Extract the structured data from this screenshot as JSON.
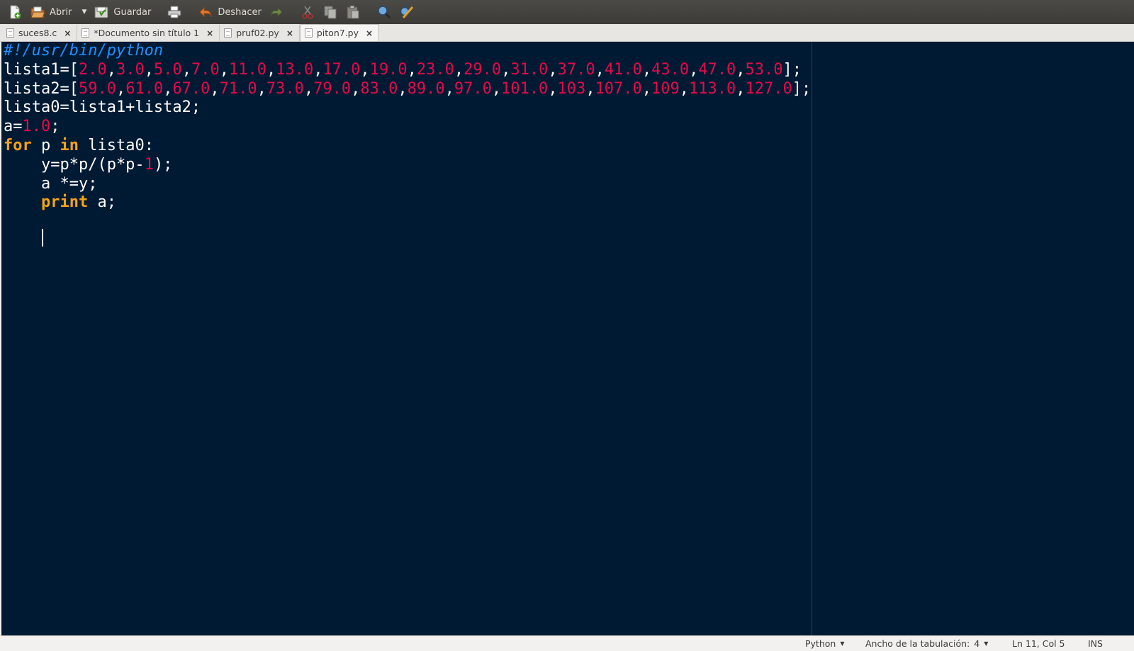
{
  "toolbar": {
    "new_icon": "new-document-icon",
    "open_label": "Abrir",
    "save_label": "Guardar",
    "undo_label": "Deshacer"
  },
  "tabs": [
    {
      "label": "suces8.c",
      "close": "×"
    },
    {
      "label": "*Documento sin título 1",
      "close": "×"
    },
    {
      "label": "pruf02.py",
      "close": "×"
    },
    {
      "label": "piton7.py",
      "close": "×",
      "active": true
    }
  ],
  "editor": {
    "lines": [
      [
        {
          "t": "#!/usr/bin/python",
          "c": "cm"
        }
      ],
      [
        {
          "t": "lista1=[",
          "c": ""
        },
        {
          "t": "2.0",
          "c": "num"
        },
        {
          "t": ",",
          "c": ""
        },
        {
          "t": "3.0",
          "c": "num"
        },
        {
          "t": ",",
          "c": ""
        },
        {
          "t": "5.0",
          "c": "num"
        },
        {
          "t": ",",
          "c": ""
        },
        {
          "t": "7.0",
          "c": "num"
        },
        {
          "t": ",",
          "c": ""
        },
        {
          "t": "11.0",
          "c": "num"
        },
        {
          "t": ",",
          "c": ""
        },
        {
          "t": "13.0",
          "c": "num"
        },
        {
          "t": ",",
          "c": ""
        },
        {
          "t": "17.0",
          "c": "num"
        },
        {
          "t": ",",
          "c": ""
        },
        {
          "t": "19.0",
          "c": "num"
        },
        {
          "t": ",",
          "c": ""
        },
        {
          "t": "23.0",
          "c": "num"
        },
        {
          "t": ",",
          "c": ""
        },
        {
          "t": "29.0",
          "c": "num"
        },
        {
          "t": ",",
          "c": ""
        },
        {
          "t": "31.0",
          "c": "num"
        },
        {
          "t": ",",
          "c": ""
        },
        {
          "t": "37.0",
          "c": "num"
        },
        {
          "t": ",",
          "c": ""
        },
        {
          "t": "41.0",
          "c": "num"
        },
        {
          "t": ",",
          "c": ""
        },
        {
          "t": "43.0",
          "c": "num"
        },
        {
          "t": ",",
          "c": ""
        },
        {
          "t": "47.0",
          "c": "num"
        },
        {
          "t": ",",
          "c": ""
        },
        {
          "t": "53.0",
          "c": "num"
        },
        {
          "t": "];",
          "c": ""
        }
      ],
      [
        {
          "t": "lista2=[",
          "c": ""
        },
        {
          "t": "59.0",
          "c": "num"
        },
        {
          "t": ",",
          "c": ""
        },
        {
          "t": "61.0",
          "c": "num"
        },
        {
          "t": ",",
          "c": ""
        },
        {
          "t": "67.0",
          "c": "num"
        },
        {
          "t": ",",
          "c": ""
        },
        {
          "t": "71.0",
          "c": "num"
        },
        {
          "t": ",",
          "c": ""
        },
        {
          "t": "73.0",
          "c": "num"
        },
        {
          "t": ",",
          "c": ""
        },
        {
          "t": "79.0",
          "c": "num"
        },
        {
          "t": ",",
          "c": ""
        },
        {
          "t": "83.0",
          "c": "num"
        },
        {
          "t": ",",
          "c": ""
        },
        {
          "t": "89.0",
          "c": "num"
        },
        {
          "t": ",",
          "c": ""
        },
        {
          "t": "97.0",
          "c": "num"
        },
        {
          "t": ",",
          "c": ""
        },
        {
          "t": "101.0",
          "c": "num"
        },
        {
          "t": ",",
          "c": ""
        },
        {
          "t": "103",
          "c": "num"
        },
        {
          "t": ",",
          "c": ""
        },
        {
          "t": "107.0",
          "c": "num"
        },
        {
          "t": ",",
          "c": ""
        },
        {
          "t": "109",
          "c": "num"
        },
        {
          "t": ",",
          "c": ""
        },
        {
          "t": "113.0",
          "c": "num"
        },
        {
          "t": ",",
          "c": ""
        },
        {
          "t": "127.0",
          "c": "num"
        },
        {
          "t": "];",
          "c": ""
        }
      ],
      [
        {
          "t": "lista0=lista1+lista2;",
          "c": ""
        }
      ],
      [
        {
          "t": "a=",
          "c": ""
        },
        {
          "t": "1.0",
          "c": "num"
        },
        {
          "t": ";",
          "c": ""
        }
      ],
      [
        {
          "t": "for",
          "c": "kw"
        },
        {
          "t": " p ",
          "c": ""
        },
        {
          "t": "in",
          "c": "kw"
        },
        {
          "t": " lista0:",
          "c": ""
        }
      ],
      [
        {
          "t": "    y=p*p/(p*p-",
          "c": ""
        },
        {
          "t": "1",
          "c": "num"
        },
        {
          "t": ");",
          "c": ""
        }
      ],
      [
        {
          "t": "    a *=y;",
          "c": ""
        }
      ],
      [
        {
          "t": "    ",
          "c": ""
        },
        {
          "t": "print",
          "c": "kw"
        },
        {
          "t": " a;",
          "c": ""
        }
      ],
      [
        {
          "t": "",
          "c": ""
        }
      ],
      [
        {
          "t": "    ",
          "c": ""
        }
      ]
    ]
  },
  "statusbar": {
    "language": "Python",
    "tab_width_label": "Ancho de la tabulación:",
    "tab_width_value": "4",
    "position": "Ln 11, Col 5",
    "mode": "INS"
  },
  "colors": {
    "editor_bg": "#001a33",
    "comment": "#1e90ff",
    "number": "#e8084a",
    "keyword": "#f5a316"
  }
}
